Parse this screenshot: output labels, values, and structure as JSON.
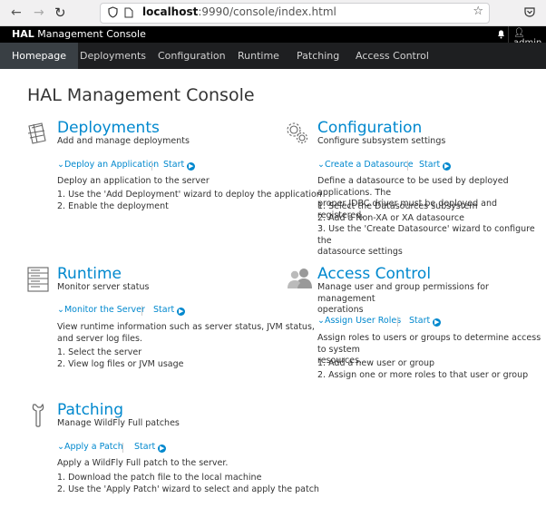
{
  "browser": {
    "url_host": "localhost",
    "url_rest": ":9990/console/index.html"
  },
  "header": {
    "brand_bold": "HAL",
    "brand_rest": " Management Console",
    "user": "admin"
  },
  "nav": {
    "tabs": [
      {
        "label": "Homepage",
        "active": true
      },
      {
        "label": "Deployments"
      },
      {
        "label": "Configuration"
      },
      {
        "label": "Runtime"
      },
      {
        "label": "Patching"
      },
      {
        "label": "Access Control"
      }
    ]
  },
  "main": {
    "title": "HAL Management Console",
    "cards": {
      "deployments": {
        "title": "Deployments",
        "subtitle": "Add and manage deployments",
        "action": "Deploy an Application",
        "start": "Start",
        "description": "Deploy an application to the server",
        "steps": [
          "1. Use the 'Add Deployment' wizard to deploy the application",
          "2. Enable the deployment"
        ]
      },
      "configuration": {
        "title": "Configuration",
        "subtitle": "Configure subsystem settings",
        "action": "Create a Datasource",
        "start": "Start",
        "description_1": "Define a datasource to be used by deployed applications. The",
        "description_2": "proper JDBC driver must be deployed and registered.",
        "steps": [
          "1. Select the Datasources subsystem",
          "2. Add a Non-XA or XA datasource",
          "3. Use the 'Create Datasource' wizard to configure the",
          "datasource settings"
        ]
      },
      "runtime": {
        "title": "Runtime",
        "subtitle": "Monitor server status",
        "action": "Monitor the Server",
        "start": "Start",
        "description_1": "View runtime information such as server status, JVM status,",
        "description_2": "and server log files.",
        "steps": [
          "1. Select the server",
          "2. View log files or JVM usage"
        ]
      },
      "access": {
        "title": "Access Control",
        "subtitle_1": "Manage user and group permissions for management",
        "subtitle_2": "operations",
        "action": "Assign User Roles",
        "start": "Start",
        "description_1": "Assign roles to users or groups to determine access to system",
        "description_2": "resources.",
        "steps": [
          "1. Add a new user or group",
          "2. Assign one or more roles to that user or group"
        ]
      },
      "patching": {
        "title": "Patching",
        "subtitle": "Manage WildFly Full patches",
        "action": "Apply a Patch",
        "start": "Start",
        "description": "Apply a WildFly Full patch to the server.",
        "steps": [
          "1. Download the patch file to the local machine",
          "2. Use the 'Apply Patch' wizard to select and apply the patch"
        ]
      }
    }
  }
}
